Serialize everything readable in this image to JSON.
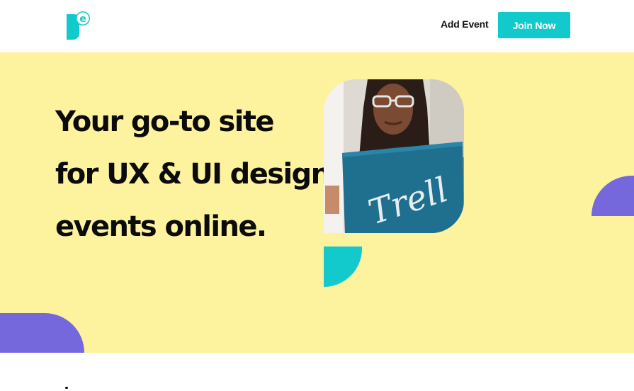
{
  "header": {
    "logo_icon": "brand-logo-e-icon",
    "add_event_label": "Add Event",
    "join_label": "Join Now",
    "join_color": "#12c9cc"
  },
  "hero": {
    "title_lines": [
      "Your go-to site",
      "for UX & UI design",
      "events online."
    ],
    "background_color": "#fdf29e",
    "photo_icon": "person-with-trello-laptop-photo",
    "accent_purple": "#7568dc",
    "accent_teal": "#12c9cc"
  }
}
